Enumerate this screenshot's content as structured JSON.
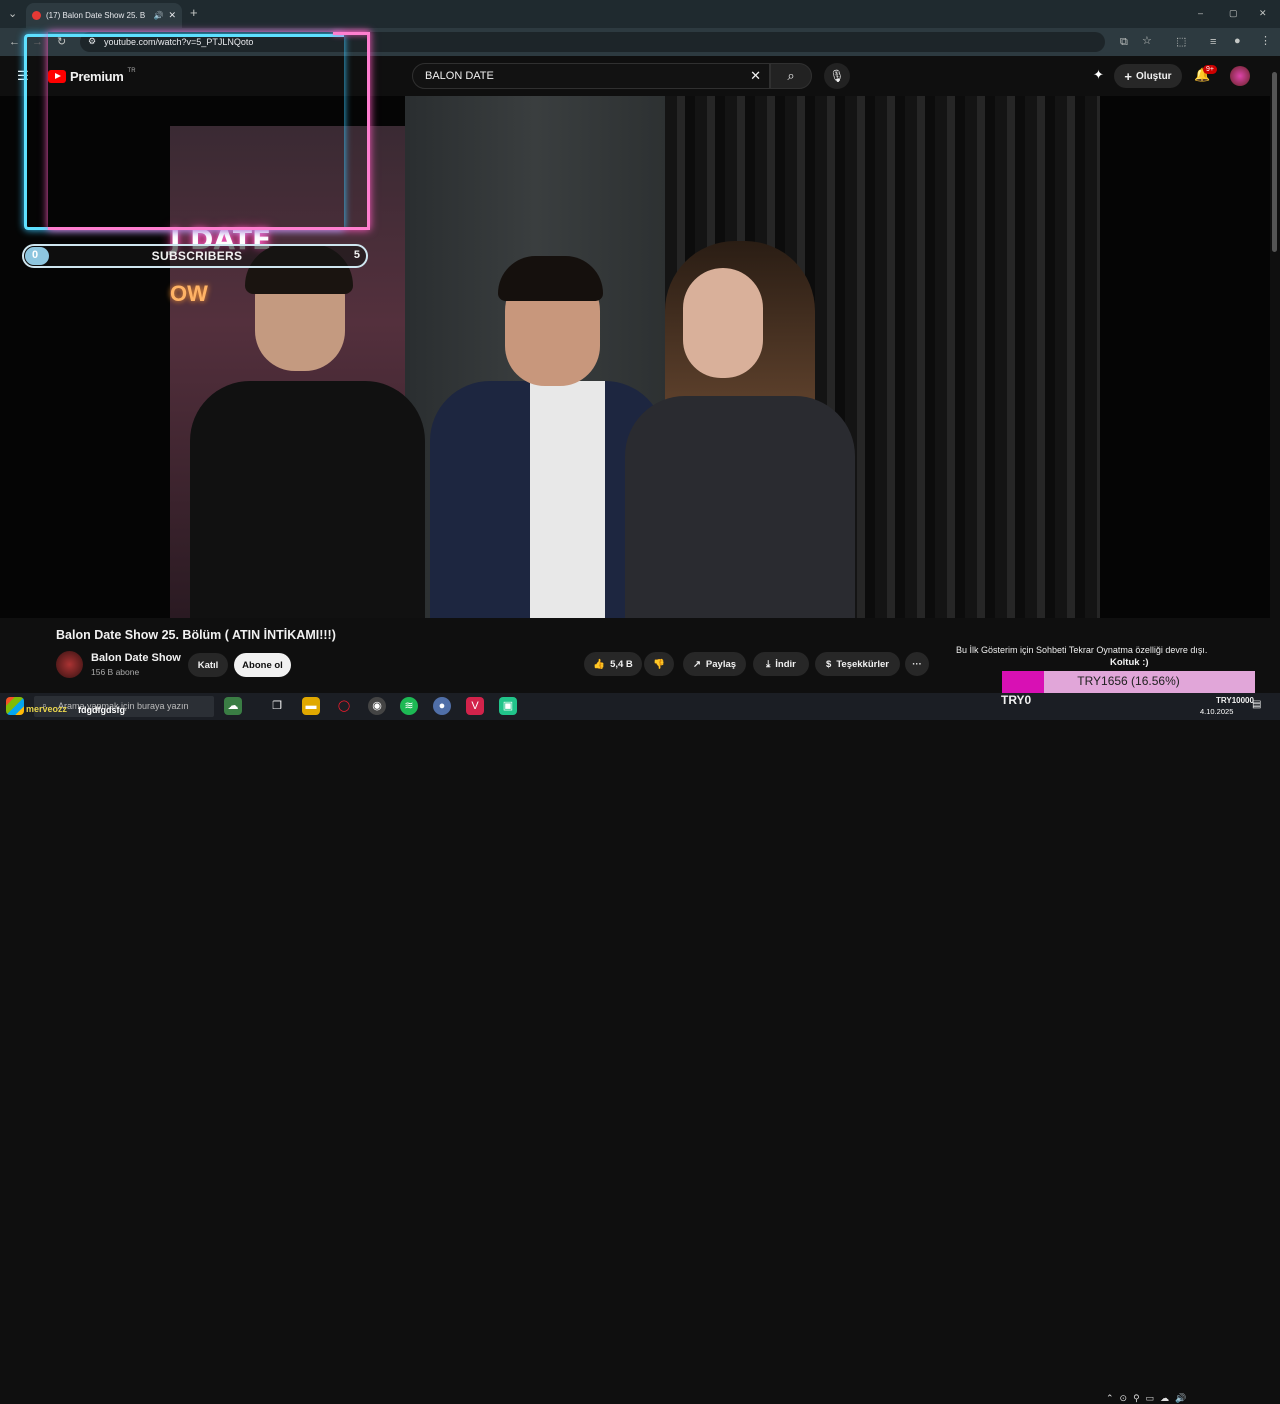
{
  "browser": {
    "tab_title": "(17) Balon Date Show 25. B",
    "url": "youtube.com/watch?v=5_PTJLNQoto",
    "new_tab_glyph": "+",
    "window_controls": [
      "–",
      "▢",
      "✕"
    ]
  },
  "youtube": {
    "logo_text": "Premium",
    "logo_region": "TR",
    "search_value": "BALON DATE",
    "create_label": "Oluştur",
    "notifications_badge": "9+"
  },
  "overlay": {
    "subscribers_label": "SUBSCRIBERS",
    "subscribers_current": "0",
    "subscribers_goal": "5",
    "neon_line1": "J DATE",
    "neon_line2": "OW"
  },
  "video_info": {
    "title": "Balon Date Show 25. Bölüm ( ATIN İNTİKAMI!!!)",
    "channel_name": "Balon Date Show",
    "channel_subs": "156 B abone",
    "join_label": "Katıl",
    "subscribe_label": "Abone ol",
    "likes": "5,4 B",
    "share_label": "Paylaş",
    "download_label": "İndir",
    "thanks_label": "Teşekkürler",
    "more_glyph": "···"
  },
  "chat_note": "Bu İlk Gösterim için Sohbeti Tekrar Oynatma özelliği devre dışı.",
  "donation": {
    "title": "Koltuk :)",
    "progress_text": "TRY1656 (16.56%)",
    "progress_fraction": 0.1656,
    "start_label": "TRY0",
    "goal_label": "TRY10000",
    "fill_color": "#d810b4",
    "track_color": "#e1a6d9"
  },
  "taskbar": {
    "search_placeholder": "Arama yapmak için buraya yazın",
    "overlay_user": "merveozz",
    "overlay_msg": "fdgdfgdsfg",
    "date": "4.10.2025"
  }
}
